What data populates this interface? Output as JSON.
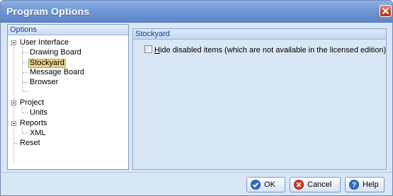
{
  "window": {
    "title": "Program Options"
  },
  "tree": {
    "header": "Options",
    "nodes": [
      {
        "label": "User Interface",
        "expanded": true
      },
      {
        "label": "Drawing Board"
      },
      {
        "label": "Stockyard",
        "selected": true
      },
      {
        "label": "Message Board"
      },
      {
        "label": "Browser"
      },
      {
        "label": "Project",
        "expanded": true
      },
      {
        "label": "Units"
      },
      {
        "label": "Reports",
        "expanded": true
      },
      {
        "label": "XML"
      },
      {
        "label": "Reset"
      }
    ]
  },
  "content": {
    "header": "Stockyard",
    "option": {
      "mnemonic": "H",
      "label_rest": "ide disabled items (which are not available in the licensed edition)",
      "checked": false
    }
  },
  "buttons": {
    "ok": "OK",
    "cancel": "Cancel",
    "help": "Help"
  },
  "colors": {
    "titlebar": "#6f97d5",
    "dialog_bg": "#d9e6f6",
    "selection": "#ecd58a",
    "header_text": "#15428b"
  },
  "icons": {
    "ok": "ok-check-icon",
    "cancel": "cancel-x-icon",
    "help": "help-question-icon",
    "close": "close-icon"
  }
}
